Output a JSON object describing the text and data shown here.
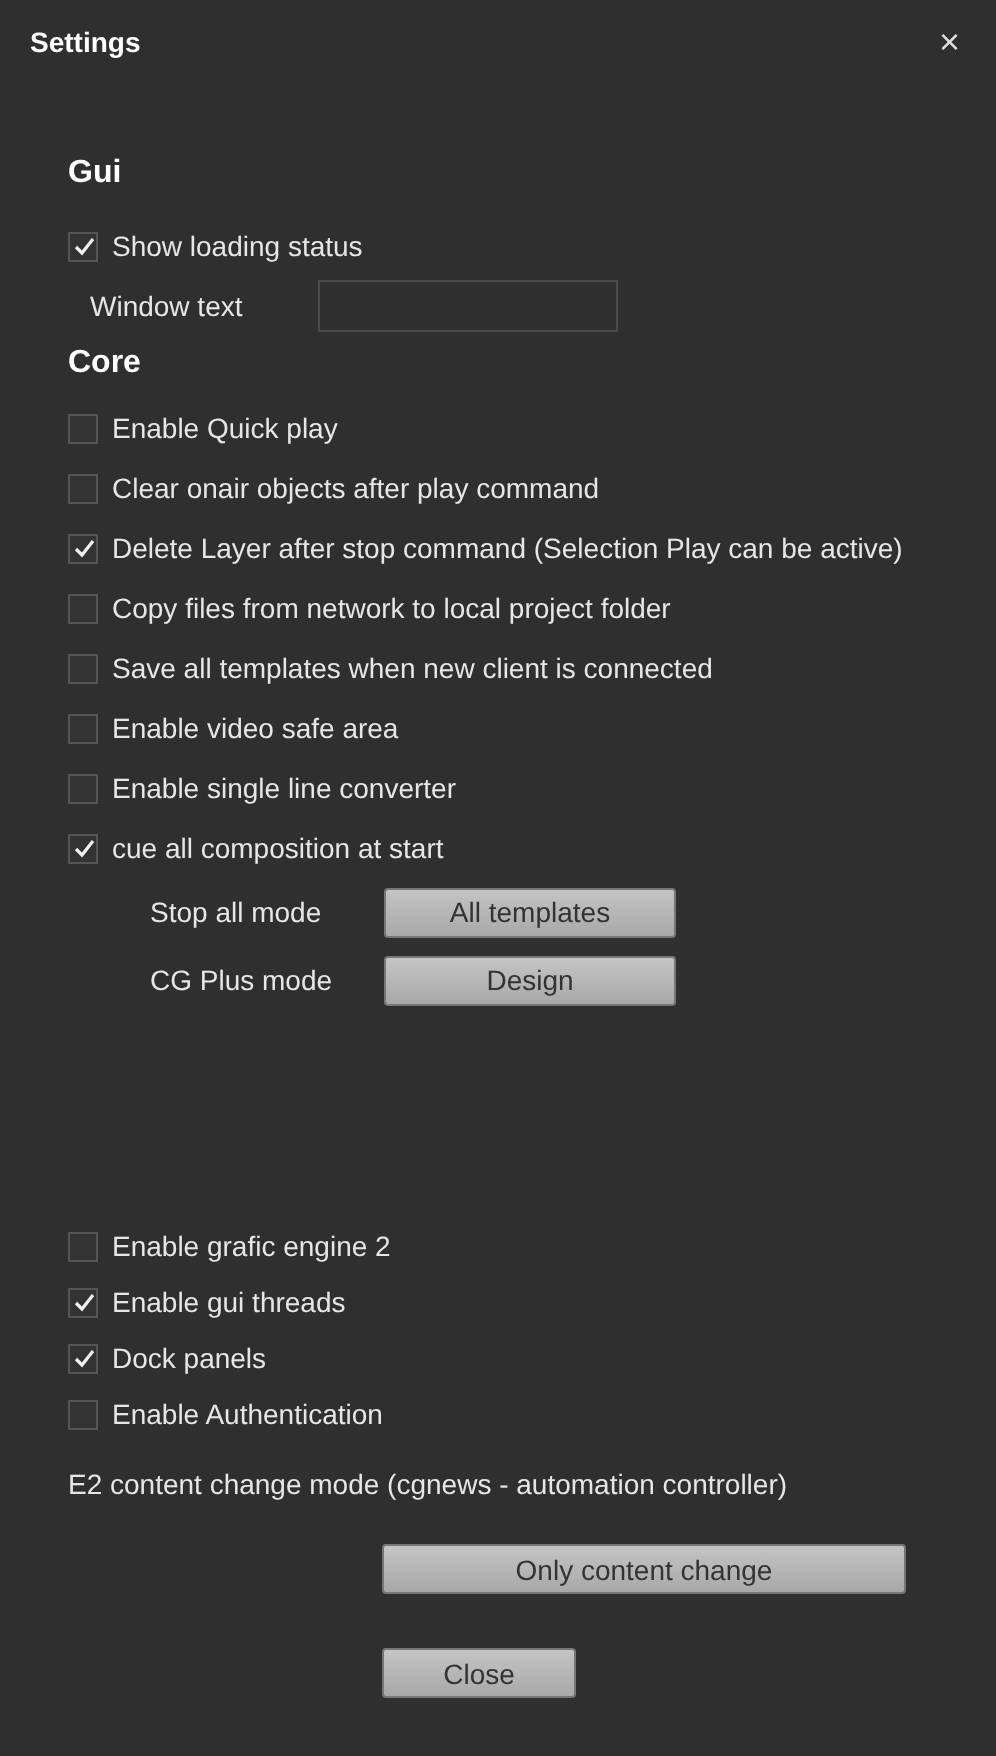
{
  "window": {
    "title": "Settings",
    "close": "×"
  },
  "sections": [
    {
      "heading": "Gui",
      "items": [
        {
          "kind": "checkbox",
          "label": "Show loading status",
          "checked": true
        },
        {
          "kind": "text_field",
          "label": "Window text"
        }
      ]
    },
    {
      "heading": "Core",
      "items": [
        {
          "kind": "checkbox",
          "label": "Enable Quick play",
          "checked": false
        },
        {
          "kind": "checkbox",
          "label": "Clear onair objects after play command",
          "checked": false
        },
        {
          "kind": "checkbox",
          "label": "Delete Layer after stop command (Selection Play can be active)",
          "checked": true
        },
        {
          "kind": "checkbox",
          "label": "Copy files from network to local project folder",
          "checked": false
        },
        {
          "kind": "checkbox",
          "label": "Save all templates when new client is connected",
          "checked": false
        },
        {
          "kind": "checkbox",
          "label": "Enable video safe area",
          "checked": false
        },
        {
          "kind": "checkbox",
          "label": "Enable single line converter",
          "checked": false
        },
        {
          "kind": "checkbox",
          "label": "cue all composition at start",
          "checked": true
        },
        {
          "kind": "select",
          "label": "Stop all mode",
          "value": "All templates"
        },
        {
          "kind": "select",
          "label": "CG Plus mode",
          "value": "Design"
        }
      ]
    }
  ],
  "engine_options": [
    {
      "label": "Enable grafic engine 2",
      "checked": false
    },
    {
      "label": "Enable gui threads",
      "checked": true
    },
    {
      "label": "Dock panels",
      "checked": true
    },
    {
      "label": "Enable Authentication",
      "checked": false
    }
  ],
  "content_change": {
    "label": "E2 content change mode (cgnews - automation controller)",
    "value": "Only content change"
  },
  "close_button": "Close"
}
